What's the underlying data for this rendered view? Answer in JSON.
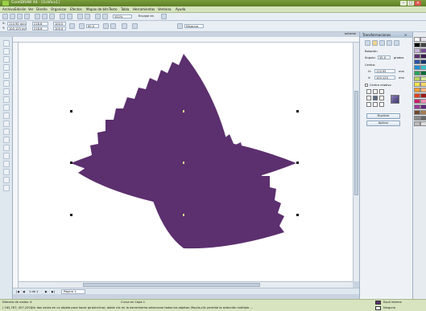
{
  "window": {
    "title": "CorelDRAW X4 - [Gráfico1]",
    "minimize": "–",
    "maximize": "□",
    "close": "✕"
  },
  "menu": [
    "Archivo",
    "Edición",
    "Ver",
    "Diseño",
    "Organizar",
    "Efectos",
    "Mapas de bits",
    "Texto",
    "Tabla",
    "Herramientas",
    "Ventana",
    "Ayuda"
  ],
  "toolbar": {
    "zoom": "152%",
    "snap": "Encajar en"
  },
  "propbar": {
    "x": "110,95 mm",
    "y": "100,125 mm",
    "w": "218,6",
    "h": "218,6",
    "w_pct": "100,0",
    "h_pct": "100,0",
    "angle": "90,0",
    "outline": "Ninguno"
  },
  "docktab": "anhame",
  "docker": {
    "title": "Transformaciones",
    "section": "Rotación",
    "angle_label": "Ángulo:",
    "angle_value": "35,0",
    "angle_unit": "grados",
    "center_label": "Centro:",
    "h_label": "H:",
    "h_value": "110,95",
    "v_label": "V:",
    "v_value": "100,125",
    "unit": "mm",
    "relative_center": "Centro relativo",
    "duplicate": "Duplicar",
    "apply": "Aplicar"
  },
  "pages": {
    "counter": "1 de 1",
    "tab": "Página 1"
  },
  "status": {
    "line1_left": "Número de nodos: 4",
    "line1_mid": "Curva en Capa 1",
    "line2_left": "( 162,767; 207,220 )",
    "line2_mid": "Clic dos veces en un objeto para hacer gira/inclinar; doble clic en la herramienta selecciona todos los objetos; Mayús-clic permite la selección múltiple ...",
    "fill_label": "R:0 G:0 B:0 (#000000)",
    "fill_name": "Equil interno",
    "outline_name": "Ninguno"
  },
  "colors": {
    "shape": "#5c2f6e",
    "titlebar": "#6a8f31",
    "menubar": "#d7e4bf",
    "canvas": "#ffffff",
    "workspace": "#c9d3e0"
  }
}
